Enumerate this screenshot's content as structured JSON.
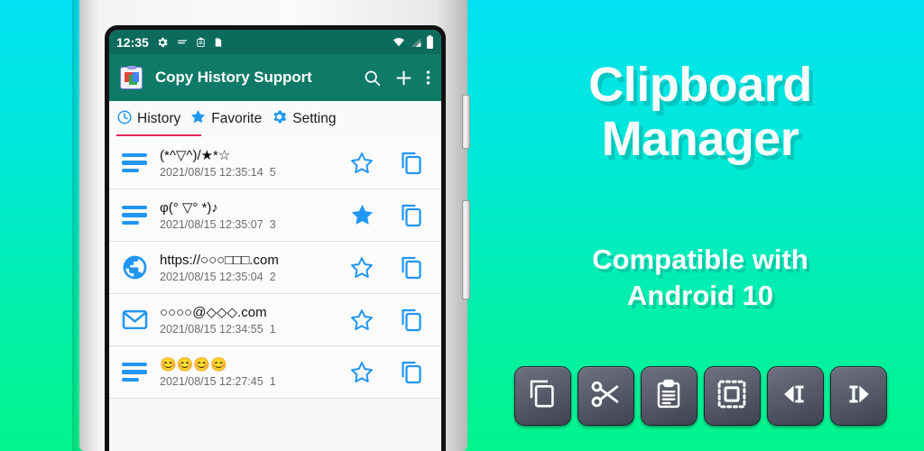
{
  "background": {
    "top_color": "#00E2F2",
    "bottom_color": "#00F58C"
  },
  "phone": {
    "status_bar": {
      "time": "12:35",
      "left_icons": [
        "gear-icon",
        "menu-lines-icon",
        "clipboard-icon",
        "sdcard-icon"
      ],
      "right_icons": [
        "wifi-icon",
        "signal-icon",
        "battery-icon"
      ],
      "background_color": "#0d6b5e"
    },
    "app_bar": {
      "icon": "clipboard-app-icon",
      "title": "Copy History Support",
      "actions": [
        "search-icon",
        "add-icon",
        "overflow-menu-icon"
      ],
      "background_color": "#0f7a68"
    },
    "tabs": {
      "items": [
        {
          "label": "History",
          "icon": "clock-icon",
          "selected": true
        },
        {
          "label": "Favorite",
          "icon": "star-icon",
          "selected": false
        },
        {
          "label": "Setting",
          "icon": "gear-icon",
          "selected": false
        }
      ],
      "indicator_color": "#e8275a"
    },
    "list": {
      "accent_color": "#2196f3",
      "items": [
        {
          "lead_icon": "text-lines-icon",
          "text": "(*^▽^)/★*☆",
          "timestamp": "2021/08/15 12:35:14",
          "count": "5",
          "favorite": false,
          "copy_icon": "copy-icon"
        },
        {
          "lead_icon": "text-lines-icon",
          "text": "φ(° ▽° *)♪",
          "timestamp": "2021/08/15 12:35:07",
          "count": "3",
          "favorite": true,
          "copy_icon": "copy-icon"
        },
        {
          "lead_icon": "globe-icon",
          "text": "https://○○○□□□.com",
          "timestamp": "2021/08/15 12:35:04",
          "count": "2",
          "favorite": false,
          "copy_icon": "copy-icon"
        },
        {
          "lead_icon": "mail-icon",
          "text": "○○○○@◇◇◇.com",
          "timestamp": "2021/08/15 12:34:55",
          "count": "1",
          "favorite": false,
          "copy_icon": "copy-icon"
        },
        {
          "lead_icon": "text-lines-icon",
          "text": "😊😊😊😊",
          "timestamp": "2021/08/15 12:27:45",
          "count": "1",
          "favorite": false,
          "copy_icon": "copy-icon"
        }
      ]
    },
    "hardware_buttons": [
      "volume-rocker",
      "power-button"
    ]
  },
  "promo": {
    "title_line1": "Clipboard",
    "title_line2": "Manager",
    "subtitle_line1": "Compatible with",
    "subtitle_line2": "Android 10",
    "text_color": "#ffffff",
    "toolbar_buttons": [
      {
        "name": "copy-button",
        "icon": "copy-icon"
      },
      {
        "name": "cut-button",
        "icon": "scissors-icon"
      },
      {
        "name": "paste-button",
        "icon": "clipboard-paste-icon"
      },
      {
        "name": "select-all-button",
        "icon": "select-all-icon"
      },
      {
        "name": "cursor-left-button",
        "icon": "caret-left-icon"
      },
      {
        "name": "cursor-right-button",
        "icon": "caret-right-icon"
      }
    ]
  }
}
